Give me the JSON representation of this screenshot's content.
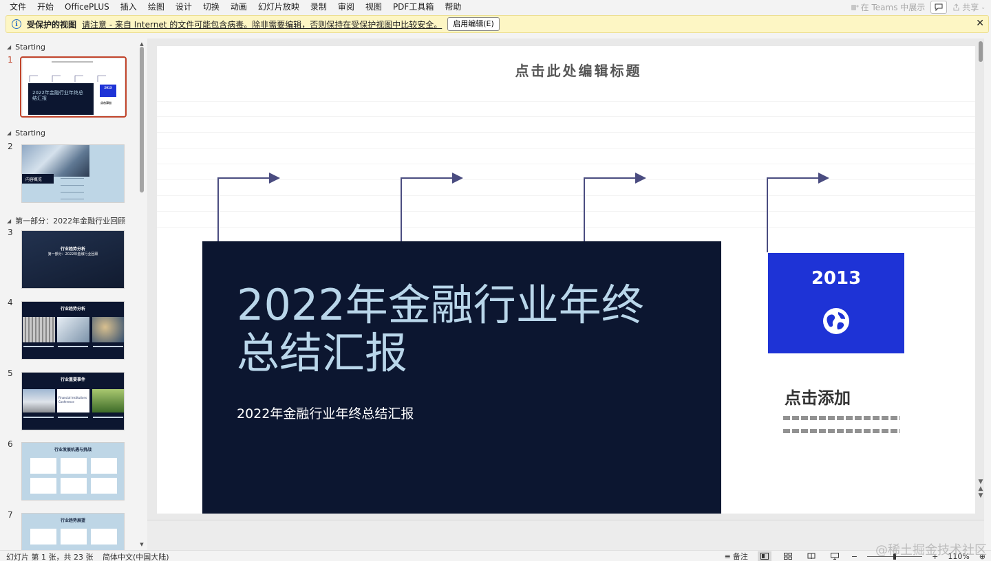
{
  "menu": {
    "items": [
      "文件",
      "开始",
      "OfficePLUS",
      "插入",
      "绘图",
      "设计",
      "切换",
      "动画",
      "幻灯片放映",
      "录制",
      "审阅",
      "视图",
      "PDF工具箱",
      "帮助"
    ],
    "teams": "在 Teams 中展示",
    "share": "共享"
  },
  "protected_bar": {
    "title": "受保护的视图",
    "message": "请注意 - 来自 Internet 的文件可能包含病毒。除非需要编辑，否则保持在受保护视图中比较安全。",
    "enable_button": "启用编辑(E)"
  },
  "thumbnails": {
    "sections": [
      "Starting",
      "Starting",
      "第一部分：2022年金融行业回顾"
    ],
    "slides": [
      {
        "num": "1",
        "title": "2022年金融行业年终总结汇报",
        "year": "2013",
        "add": "点击添加"
      },
      {
        "num": "2",
        "title": "内容概览"
      },
      {
        "num": "3",
        "title": "行业趋势分析",
        "subtitle": "第一部分：2022年金融行业回顾"
      },
      {
        "num": "4",
        "title": "行业趋势分析"
      },
      {
        "num": "5",
        "title": "行业重要事件",
        "conf1": "Financial Institutions",
        "conf2": "Conference"
      },
      {
        "num": "6",
        "title": "行业发展机遇与挑战"
      },
      {
        "num": "7",
        "title": "行业趋势展望"
      }
    ]
  },
  "slide": {
    "placeholder_title": "点击此处编辑标题",
    "main_title_line1": "2022年金融行业年终",
    "main_title_line2": "总结汇报",
    "subtitle": "2022年金融行业年终总结汇报",
    "year": "2013",
    "add_title": "点击添加"
  },
  "status": {
    "slide_info": "幻灯片 第 1 张，共 23 张",
    "language": "简体中文(中国大陆)",
    "notes": "备注",
    "zoom": "110%"
  },
  "watermark": "@稀土掘金技术社区",
  "colors": {
    "accent": "#c0432a",
    "dark_navy": "#0c1630",
    "title_blue": "#b9d6ea",
    "box_blue": "#1e33d6",
    "protected_bar": "#fdf6c4"
  }
}
